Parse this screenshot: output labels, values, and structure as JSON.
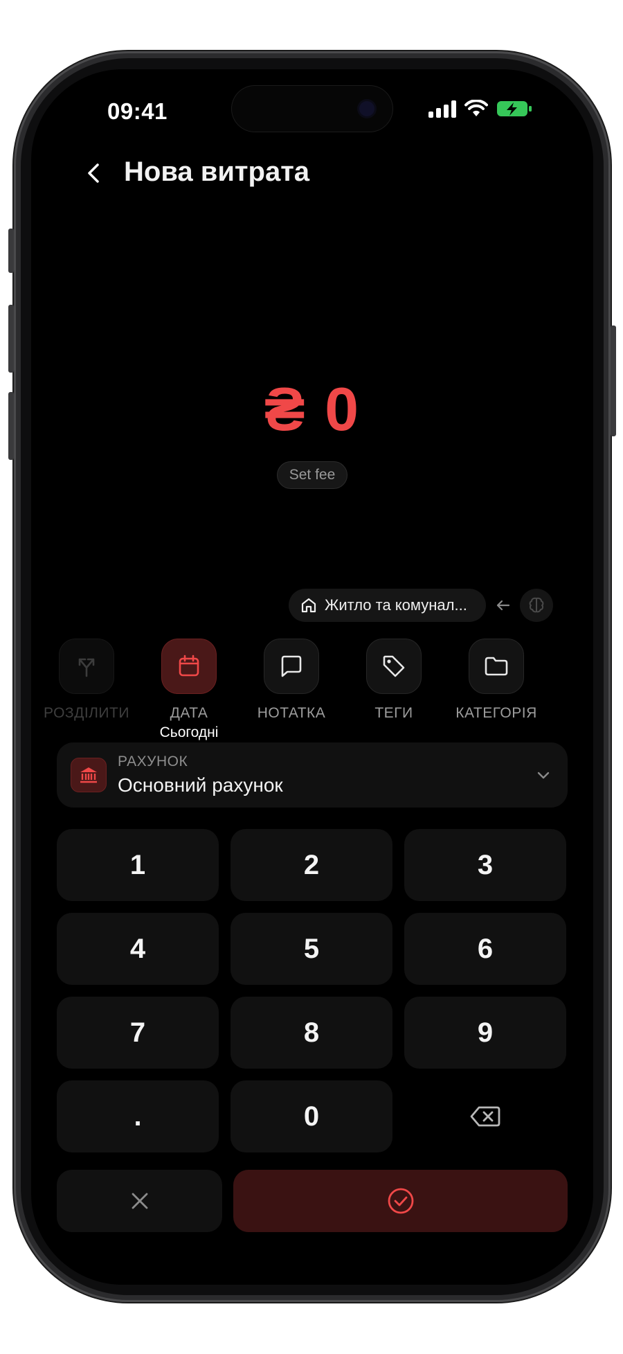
{
  "status_bar": {
    "time": "09:41"
  },
  "header": {
    "title": "Нова витрата"
  },
  "amount": {
    "currency_symbol": "₴",
    "value": "0",
    "fee_label": "Set fee"
  },
  "category_suggestion": {
    "label": "Житло та комунал..."
  },
  "actions": [
    {
      "label": "РОЗДІЛИТИ",
      "sublabel": "",
      "state": "disabled",
      "icon": "split-icon"
    },
    {
      "label": "ДАТА",
      "sublabel": "Сьогодні",
      "state": "active",
      "icon": "calendar-icon"
    },
    {
      "label": "НОТАТКА",
      "sublabel": "",
      "state": "normal",
      "icon": "chat-icon"
    },
    {
      "label": "ТЕГИ",
      "sublabel": "",
      "state": "normal",
      "icon": "tag-icon"
    },
    {
      "label": "КАТЕГОРІЯ",
      "sublabel": "",
      "state": "normal",
      "icon": "folder-icon"
    }
  ],
  "account": {
    "label": "РАХУНОК",
    "name": "Основний рахунок"
  },
  "keypad": {
    "keys": [
      "1",
      "2",
      "3",
      "4",
      "5",
      "6",
      "7",
      "8",
      "9",
      ".",
      "0"
    ]
  },
  "colors": {
    "accent": "#f04848",
    "accent_dark": "#3a1212",
    "background": "#000000",
    "surface": "#111111"
  }
}
